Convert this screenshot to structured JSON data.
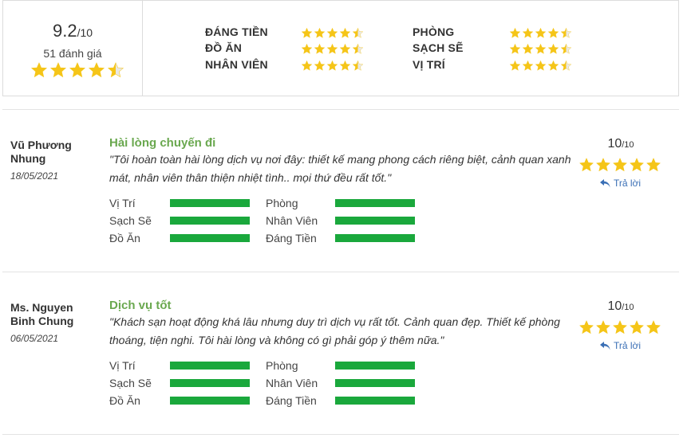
{
  "summary": {
    "score": "9.2",
    "score_denominator": "/10",
    "review_count": "51 đánh giá",
    "rating_stars": 4.5,
    "categories": [
      {
        "label": "ĐÁNG TIỀN",
        "stars": 4.5
      },
      {
        "label": "ĐỒ ĂN",
        "stars": 4.5
      },
      {
        "label": "NHÂN VIÊN",
        "stars": 4.5
      },
      {
        "label": "PHÒNG",
        "stars": 4.5
      },
      {
        "label": "SẠCH SẼ",
        "stars": 4.5
      },
      {
        "label": "VỊ TRÍ",
        "stars": 4.5
      }
    ]
  },
  "reviews": [
    {
      "name": "Vũ Phương Nhung",
      "date": "18/05/2021",
      "title": "Hài lòng chuyến đi",
      "text": "\"Tôi hoàn toàn hài lòng dịch vụ nơi đây: thiết kế mang phong cách riêng biệt, cảnh quan xanh mát, nhân viên thân thiện nhiệt tình.. mọi thứ đều rất tốt.\"",
      "score": "10",
      "score_denominator": "/10",
      "stars": 5,
      "reply_label": "Trả lời",
      "metrics": [
        {
          "label": "Vị Trí",
          "value": 1.0
        },
        {
          "label": "Phòng",
          "value": 1.0
        },
        {
          "label": "Sạch Sẽ",
          "value": 1.0
        },
        {
          "label": "Nhân Viên",
          "value": 1.0
        },
        {
          "label": "Đồ Ăn",
          "value": 1.0
        },
        {
          "label": "Đáng Tiền",
          "value": 1.0
        }
      ]
    },
    {
      "name": "Ms. Nguyen Binh Chung",
      "date": "06/05/2021",
      "title": "Dịch vụ tốt",
      "text": "\"Khách sạn hoạt động khá lâu nhưng duy trì dịch vụ rất tốt. Cảnh quan đẹp. Thiết kế phòng thoáng, tiện nghi. Tôi hài lòng và không có gì phải góp ý thêm nữa.\"",
      "score": "10",
      "score_denominator": "/10",
      "stars": 5,
      "reply_label": "Trả lời",
      "metrics": [
        {
          "label": "Vị Trí",
          "value": 1.0
        },
        {
          "label": "Phòng",
          "value": 1.0
        },
        {
          "label": "Sạch Sẽ",
          "value": 1.0
        },
        {
          "label": "Nhân Viên",
          "value": 1.0
        },
        {
          "label": "Đồ Ăn",
          "value": 1.0
        },
        {
          "label": "Đáng Tiền",
          "value": 1.0
        }
      ]
    }
  ],
  "colors": {
    "star": "#f5c518",
    "star_empty": "#e8e8e8",
    "title_green": "#6aa84f",
    "bar_green": "#1aa83c",
    "reply_blue": "#3a6fb5"
  },
  "icons": {
    "star": "star-icon",
    "reply": "reply-arrow-icon"
  }
}
